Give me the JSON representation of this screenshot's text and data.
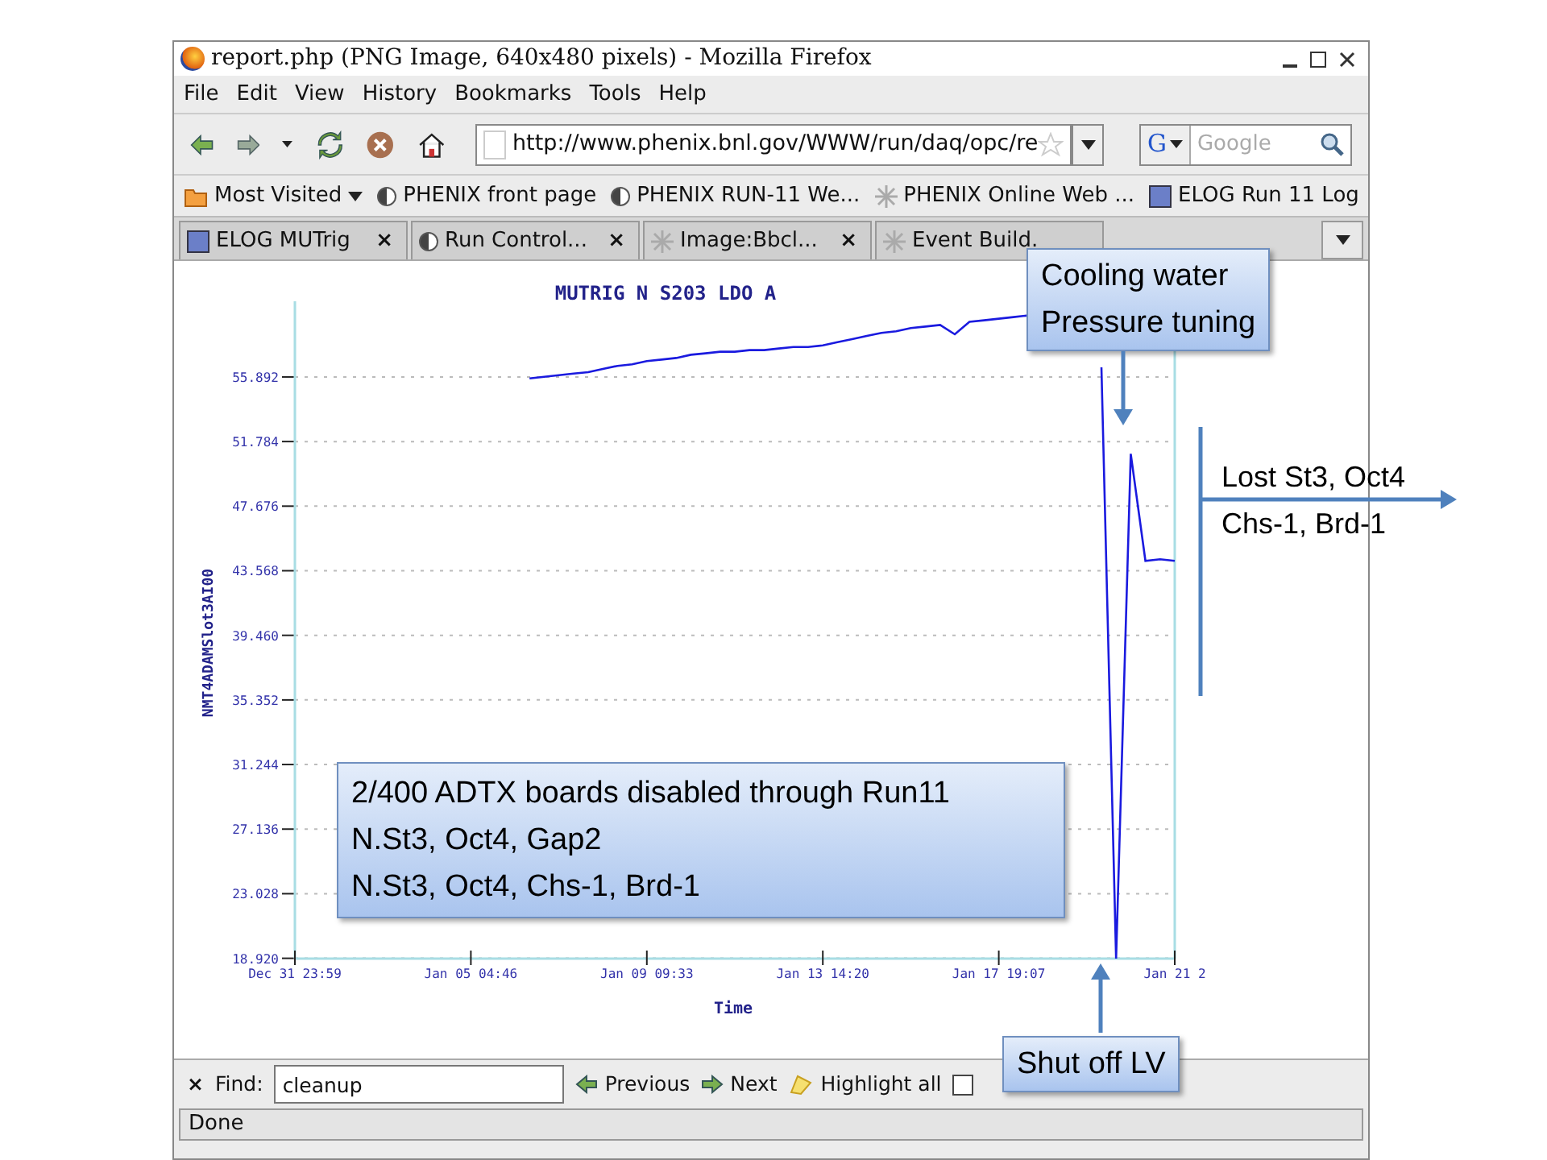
{
  "window": {
    "title": "report.php (PNG Image, 640x480 pixels) - Mozilla Firefox"
  },
  "menu": [
    "File",
    "Edit",
    "View",
    "History",
    "Bookmarks",
    "Tools",
    "Help"
  ],
  "nav": {
    "url": "http://www.phenix.bnl.gov/WWW/run/daq/opc/re",
    "engine": "G",
    "search_placeholder": "Google"
  },
  "bookmarks": [
    {
      "label": "Most Visited",
      "kind": "menu"
    },
    {
      "label": "PHENIX front page",
      "kind": "page"
    },
    {
      "label": "PHENIX RUN-11 We...",
      "kind": "page"
    },
    {
      "label": "PHENIX Online Web ...",
      "kind": "web"
    },
    {
      "label": "ELOG Run 11 Log",
      "kind": "elog"
    }
  ],
  "tabs": [
    {
      "label": "ELOG MUTrig",
      "kind": "elog",
      "selected": false,
      "close": "×"
    },
    {
      "label": "Run Control...",
      "kind": "page",
      "selected": false,
      "close": "×"
    },
    {
      "label": "Image:Bbcl...",
      "kind": "web",
      "selected": false,
      "close": "×"
    },
    {
      "label": "Event Build.",
      "kind": "web",
      "selected": false
    }
  ],
  "chart": {
    "chart_data": {
      "type": "line",
      "title": "MUTRIG N S203 LDO A",
      "xlabel": "Time",
      "ylabel": "NMT4ADAMSlot3AI00",
      "categories": [
        "Dec 31 23:59",
        null,
        null,
        null,
        null,
        null,
        null,
        null,
        null,
        null,
        null,
        null,
        "Jan 05 04:46",
        null,
        null,
        null,
        null,
        null,
        null,
        null,
        null,
        null,
        null,
        null,
        "Jan 09 09:33",
        null,
        null,
        null,
        null,
        null,
        null,
        null,
        null,
        null,
        null,
        null,
        "Jan 13 14:20",
        null,
        null,
        null,
        null,
        null,
        null,
        null,
        null,
        null,
        null,
        null,
        "Jan 17 19:07",
        null,
        null,
        null,
        null,
        null,
        null,
        null,
        null,
        null,
        null,
        null,
        "Jan 21 2"
      ],
      "series": [
        {
          "color": "#1a1adf",
          "values": [
            null,
            null,
            null,
            null,
            null,
            null,
            null,
            null,
            null,
            null,
            null,
            null,
            null,
            null,
            null,
            null,
            55.8,
            55.9,
            56.0,
            56.1,
            56.2,
            56.4,
            56.6,
            56.7,
            56.9,
            57.0,
            57.1,
            57.3,
            57.4,
            57.5,
            57.5,
            57.6,
            57.6,
            57.7,
            57.8,
            57.8,
            57.9,
            58.1,
            58.3,
            58.5,
            58.7,
            58.8,
            59.0,
            59.1,
            59.2,
            58.6,
            59.4,
            59.5,
            59.6,
            59.7,
            59.8,
            null,
            null,
            null,
            null,
            56.5,
            18.9,
            51.0,
            44.2,
            44.3,
            44.2
          ]
        }
      ],
      "ylim": [
        18.9,
        60.5
      ],
      "grid": true,
      "yticks": [
        {
          "value": 18.92,
          "label": "18.920"
        },
        {
          "value": 23.028,
          "label": "23.028"
        },
        {
          "value": 27.136,
          "label": "27.136"
        },
        {
          "value": 31.244,
          "label": "31.244"
        },
        {
          "value": 35.352,
          "label": "35.352"
        },
        {
          "value": 39.46,
          "label": "39.460"
        },
        {
          "value": 43.568,
          "label": "43.568"
        },
        {
          "value": 47.676,
          "label": "47.676"
        },
        {
          "value": 51.784,
          "label": "51.784"
        },
        {
          "value": 55.892,
          "label": "55.892"
        }
      ]
    }
  },
  "find_bar": {
    "close": "×",
    "label": "Find:",
    "value": "cleanup",
    "buttons": [
      {
        "label": "Previous",
        "kind": "prev"
      },
      {
        "label": "Next",
        "kind": "next"
      },
      {
        "label": "Highlight all",
        "kind": "highlight"
      }
    ],
    "match_case_checked": false
  },
  "status": "Done",
  "annotations": {
    "cooling": [
      "Cooling water",
      "Pressure tuning"
    ],
    "lost": [
      "Lost St3, Oct4",
      "Chs-1, Brd-1"
    ],
    "disabled": [
      "2/400 ADTX boards disabled through Run11",
      "N.St3, Oct4, Gap2",
      "N.St3, Oct4, Chs-1, Brd-1"
    ],
    "shutoff": [
      "Shut off LV"
    ]
  }
}
